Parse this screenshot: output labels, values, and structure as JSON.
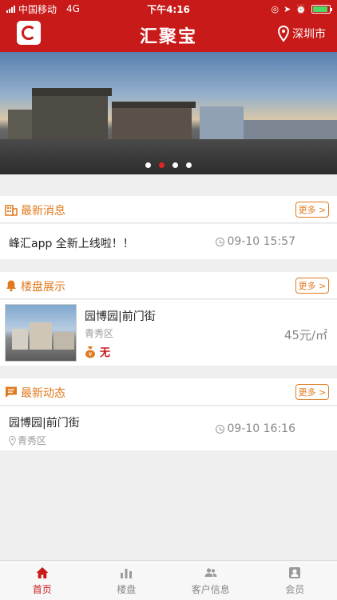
{
  "status_bar": {
    "carrier": "中国移动",
    "network": "4G",
    "time": "下午4:16"
  },
  "navbar": {
    "brand": "汇聚宝",
    "city": "深圳市"
  },
  "banner": {
    "dot_count": 4,
    "active_dot_index": 1
  },
  "news": {
    "title": "最新消息",
    "more_label": "更多 >",
    "items": [
      {
        "title": "峰汇app 全新上线啦！！",
        "time": "09-10 15:57"
      }
    ]
  },
  "properties": {
    "title": "楼盘展示",
    "more_label": "更多 >",
    "items": [
      {
        "name": "园博园|前门街",
        "district": "青秀区",
        "badge": "无",
        "price": "45元/㎡"
      }
    ]
  },
  "dynamics": {
    "title": "最新动态",
    "more_label": "更多 >",
    "items": [
      {
        "title": "园博园|前门街",
        "location": "青秀区",
        "time": "09-10 16:16"
      }
    ]
  },
  "tabbar": {
    "tabs": [
      {
        "label": "首页",
        "icon": "home-icon",
        "active": true
      },
      {
        "label": "楼盘",
        "icon": "bar-chart-icon",
        "active": false
      },
      {
        "label": "客户信息",
        "icon": "people-icon",
        "active": false
      },
      {
        "label": "会员",
        "icon": "member-icon",
        "active": false
      }
    ]
  },
  "colors": {
    "brand_red": "#c81a19",
    "accent_orange": "#e07a1f"
  }
}
